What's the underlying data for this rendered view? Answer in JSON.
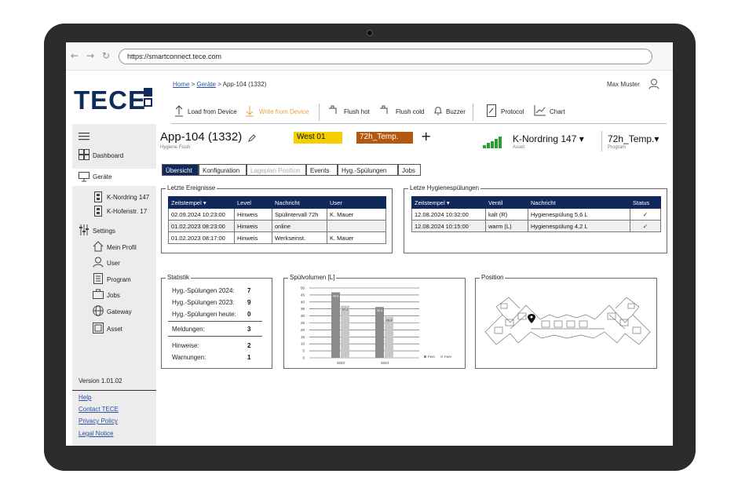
{
  "browser": {
    "url": "https://smartconnect.tece.com",
    "back": "←",
    "forward": "→",
    "reload": "↻"
  },
  "logo": {
    "text": "TECE"
  },
  "sidebar": {
    "items": [
      {
        "label": "Dashboard"
      },
      {
        "label": "Geräte"
      },
      {
        "label": "K-Nordring 147"
      },
      {
        "label": "K-Hofenstr. 17"
      },
      {
        "label": "Settings"
      },
      {
        "label": "Mein Profil"
      },
      {
        "label": "User"
      },
      {
        "label": "Program"
      },
      {
        "label": "Jobs"
      },
      {
        "label": "Gateway"
      },
      {
        "label": "Asset"
      }
    ],
    "version": "Version 1.01.02",
    "links": [
      "Help",
      "Contact TECE",
      "Privacy Policy",
      "Legal Notice"
    ]
  },
  "breadcrumb": {
    "home": "Home",
    "devices": "Geräte",
    "sep": ">",
    "current": "App-104 (1332)"
  },
  "user": {
    "name": "Max Muster"
  },
  "toolbar": {
    "load": "Load from Device",
    "write": "Write from Device",
    "flush_hot": "Flush hot",
    "flush_cold": "Flush cold",
    "buzzer": "Buzzer",
    "protocol": "Protocol",
    "chart": "Chart"
  },
  "device": {
    "title": "App-104 (1332)",
    "subtitle": "Hygiene Flush",
    "tag_west": "West 01",
    "tag_temp": "72h_Temp.",
    "add": "+",
    "asset": "K-Nordring 147 ▾",
    "asset_caption": "Asset",
    "program": "72h_Temp.▾",
    "program_caption": "Program"
  },
  "colors": {
    "navy": "#10285a",
    "yellow": "#f4d000",
    "orange": "#b4580f",
    "signal": "#2e9e2e",
    "link": "#2a4fa8"
  },
  "tabs": [
    "Übersicht",
    "Konfiguration",
    "Lageplan Position",
    "Events",
    "Hyg.-Spülungen",
    "Jobs"
  ],
  "events": {
    "title": "Letzte Ereignisse",
    "headers": [
      "Zeitstempel ▾",
      "Level",
      "Nachricht",
      "User"
    ],
    "rows": [
      [
        "02.09.2024  10:23:00",
        "Hinweis",
        "Spülintervall 72h",
        "K. Mauer"
      ],
      [
        "01.02.2023  08:23:00",
        "Hinweis",
        "online",
        ""
      ],
      [
        "01.02.2023  08:17:00",
        "Hinweis",
        "Werkseinst.",
        "K. Mauer"
      ]
    ]
  },
  "flushes": {
    "title": "Letze Hygienespülungen",
    "headers": [
      "Zeitstempel ▾",
      "Ventil",
      "Nachricht",
      "Status"
    ],
    "rows": [
      [
        "12.08.2024  10:32:00",
        "kalt (R)",
        "Hygienespülung 5,6 L",
        "✓"
      ],
      [
        "12.08.2024  10:15:00",
        "warm (L)",
        "Hygienespülung 4,2 L",
        "✓"
      ]
    ]
  },
  "stats": {
    "title": "Statistik",
    "rows": [
      {
        "label": "Hyg.-Spülungen 2024:",
        "value": "7"
      },
      {
        "label": "Hyg.-Spülungen 2023:",
        "value": "9"
      },
      {
        "label": "Hyg.-Spülungen heute:",
        "value": "0"
      },
      {
        "label": "Meldungen:",
        "value": "3"
      },
      {
        "label": "Hinweise:",
        "value": "2"
      },
      {
        "label": "Warnungen:",
        "value": "1"
      }
    ]
  },
  "chart_data": {
    "type": "bar",
    "title": "Spülvolumen [L]",
    "categories": [
      "2023",
      "2024"
    ],
    "series": [
      {
        "name": "PWC",
        "values": [
          46.9,
          36.4
        ],
        "color": "#8c8c8c"
      },
      {
        "name": "PWH",
        "values": [
          37.3,
          29.4
        ],
        "color": "#c8c8c8"
      }
    ],
    "value_labels": [
      [
        "46,9",
        "36,4"
      ],
      [
        "37,3",
        "29,4"
      ]
    ],
    "yticks": [
      0,
      5,
      10,
      15,
      20,
      25,
      30,
      35,
      40,
      45,
      50
    ],
    "ylim": [
      0,
      50
    ],
    "grid": true,
    "legend": "bottom-right"
  },
  "position": {
    "title": "Position"
  }
}
